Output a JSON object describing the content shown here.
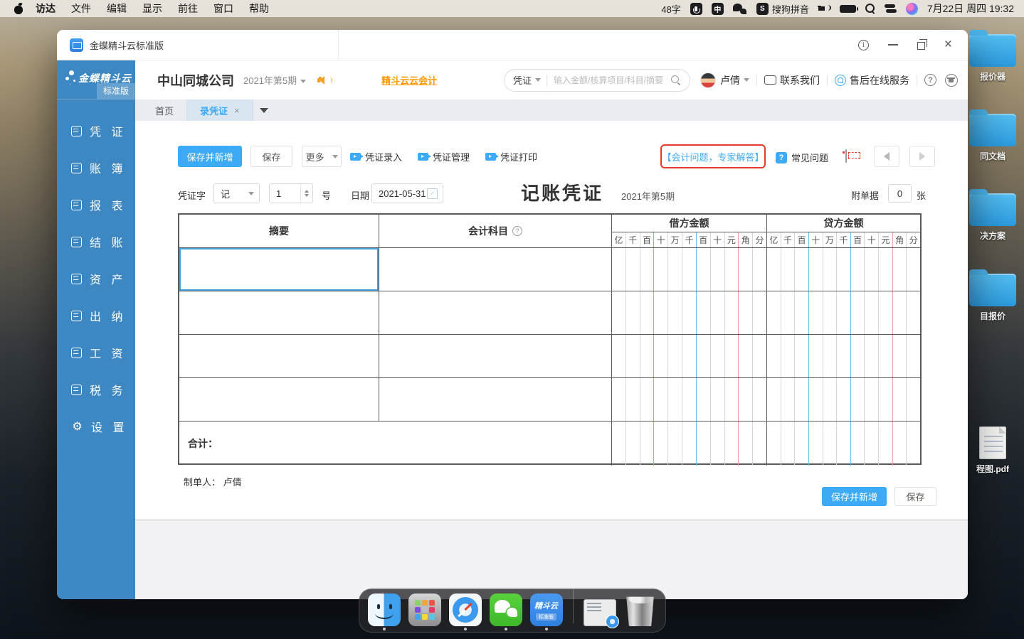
{
  "menu_bar": {
    "app_menu": "访达",
    "items": [
      "文件",
      "编辑",
      "显示",
      "前往",
      "窗口",
      "帮助"
    ],
    "status": {
      "word_count": "48字",
      "ime_badge": "中",
      "sogou_badge": "S",
      "sogou_label": "搜狗拼音",
      "datetime": "7月22日 周四 19:32"
    },
    "status_icons": [
      "mic-icon",
      "ime-icon",
      "wechat-icon",
      "sogou-icon",
      "volume-icon",
      "battery-icon",
      "spotlight-icon",
      "control-center-icon",
      "siri-icon"
    ]
  },
  "desktop": {
    "icons": [
      {
        "label": "报价器",
        "type": "folder"
      },
      {
        "label": "同文档",
        "type": "folder"
      },
      {
        "label": "决方案",
        "type": "folder"
      },
      {
        "label": "目报价",
        "type": "folder"
      },
      {
        "label": "程图.pdf",
        "type": "pdf"
      }
    ]
  },
  "window": {
    "title": "金蝶精斗云标准版"
  },
  "sidebar": {
    "logo": "金蝶精斗云",
    "badge": "标准版",
    "items": [
      {
        "icon": "voucher-icon",
        "label": "凭 证"
      },
      {
        "icon": "ledger-icon",
        "label": "账 簿"
      },
      {
        "icon": "report-icon",
        "label": "报 表"
      },
      {
        "icon": "closing-icon",
        "label": "结 账"
      },
      {
        "icon": "asset-icon",
        "label": "资 产"
      },
      {
        "icon": "cashier-icon",
        "label": "出 纳"
      },
      {
        "icon": "payroll-icon",
        "label": "工 资"
      },
      {
        "icon": "tax-icon",
        "label": "税 务"
      },
      {
        "icon": "settings-icon",
        "label": "设 置",
        "gear": true
      }
    ]
  },
  "header": {
    "company": "中山同城公司",
    "period": "2021年第5期",
    "promo_link": "精斗云云会计",
    "search_category": "凭证",
    "search_placeholder": "输入金额/核算项目/科目/摘要",
    "user": "卢倩",
    "contact": "联系我们",
    "service": "售后在线服务"
  },
  "tabs": [
    {
      "label": "首页",
      "active": false,
      "closable": false
    },
    {
      "label": "录凭证",
      "active": true,
      "closable": true
    }
  ],
  "toolbar": {
    "save_new": "保存并新增",
    "save": "保存",
    "more": "更多",
    "video_links": [
      "凭证录入",
      "凭证管理",
      "凭证打印"
    ],
    "expert_link": "【会计问题，专家解答】",
    "faq": "常见问题"
  },
  "voucher": {
    "word_label": "凭证字",
    "word_value": "记",
    "number_value": "1",
    "number_unit": "号",
    "date_label": "日期",
    "date_value": "2021-05-31",
    "title": "记账凭证",
    "period": "2021年第5期",
    "attachment_label": "附单据",
    "attachment_count": "0",
    "attachment_unit": "张"
  },
  "table": {
    "col_summary": "摘要",
    "col_account": "会计科目",
    "col_debit": "借方金额",
    "col_credit": "贷方金额",
    "digit_columns": [
      "亿",
      "千",
      "百",
      "十",
      "万",
      "千",
      "百",
      "十",
      "元",
      "角",
      "分"
    ],
    "body_rows": 4,
    "total_label": "合计："
  },
  "footer": {
    "preparer_label": "制单人：",
    "preparer": "卢倩",
    "save_new": "保存并新增",
    "save": "保存"
  },
  "dock": {
    "items": [
      {
        "name": "finder",
        "running": true
      },
      {
        "name": "launchpad",
        "running": false
      },
      {
        "name": "safari",
        "running": true
      },
      {
        "name": "wechat",
        "running": true
      },
      {
        "name": "jdy",
        "label": "精斗云",
        "sub": "标准版",
        "running": true
      },
      {
        "name": "divider"
      },
      {
        "name": "minimized-window",
        "running": false
      },
      {
        "name": "trash",
        "running": false
      }
    ]
  },
  "colors": {
    "accent_blue": "#3daaf5",
    "sidebar_blue": "#3d87c3",
    "promo_orange": "#ff9900",
    "alert_red": "#e23c2b"
  }
}
